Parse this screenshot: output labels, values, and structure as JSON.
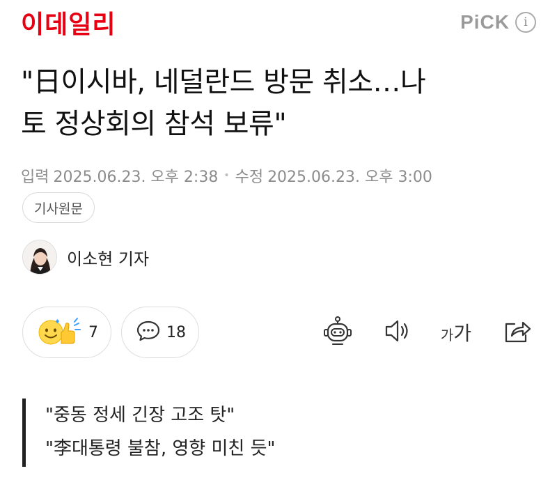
{
  "header": {
    "logo_text": "이데일리",
    "pick_label": "PiCK",
    "info_icon": "info-icon",
    "brand_color": "#e60012"
  },
  "article": {
    "headline_line1": "\"日이시바, 네덜란드 방문 취소…나",
    "headline_line2": "토 정상회의 참석 보류\"",
    "published_label": "입력",
    "published_time": "2025.06.23. 오후 2:38",
    "modified_label": "수정",
    "modified_time": "2025.06.23. 오후 3:00",
    "source_button_label": "기사원문",
    "author_name": "이소현 기자",
    "subheadings": [
      "\"중동 정세 긴장 고조 탓\"",
      "\"李대통령 불참, 영향 미친 듯\""
    ]
  },
  "reactions": {
    "like_icon": "smile-thumbs-up-icon",
    "like_count": "7",
    "comment_icon": "comment-bubble-icon",
    "comment_count": "18"
  },
  "toolbar": {
    "summary_icon": "robot-icon",
    "audio_icon": "speaker-icon",
    "font_small": "가",
    "font_large": "가",
    "share_icon": "share-icon"
  }
}
